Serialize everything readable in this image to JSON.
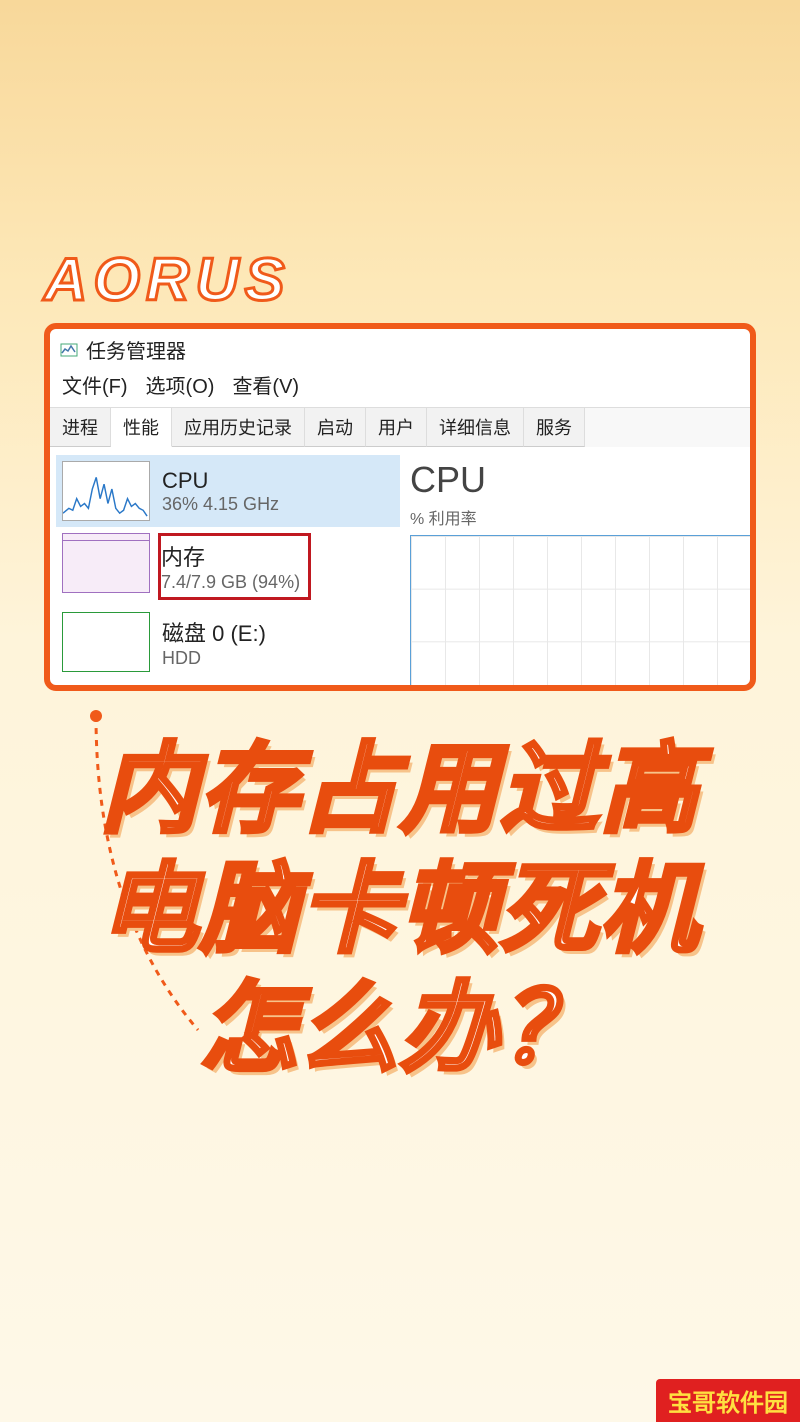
{
  "brand": "AORUS",
  "task_manager": {
    "title": "任务管理器",
    "menu": {
      "file": "文件(F)",
      "options": "选项(O)",
      "view": "查看(V)"
    },
    "tabs": {
      "processes": "进程",
      "performance": "性能",
      "app_history": "应用历史记录",
      "startup": "启动",
      "users": "用户",
      "details": "详细信息",
      "services": "服务"
    },
    "side": {
      "cpu": {
        "label": "CPU",
        "sub": "36% 4.15 GHz"
      },
      "memory": {
        "label": "内存",
        "sub": "7.4/7.9 GB (94%)"
      },
      "disk": {
        "label": "磁盘 0 (E:)",
        "sub": "HDD"
      }
    },
    "main": {
      "title": "CPU",
      "sub": "% 利用率"
    }
  },
  "headline": {
    "l1": "内存占用过高",
    "l2": "电脑卡顿死机",
    "l3": "怎么办？"
  },
  "watermark": "宝哥软件园"
}
